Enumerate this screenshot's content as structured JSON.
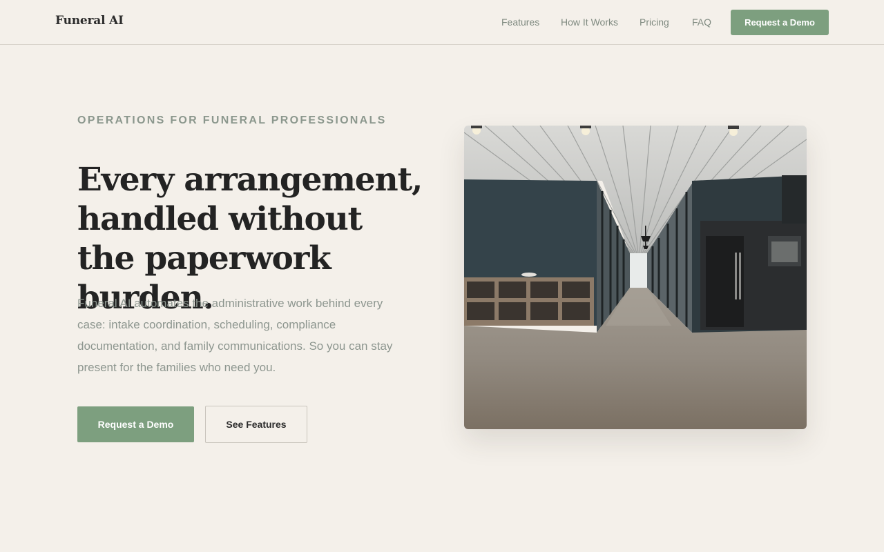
{
  "header": {
    "logo": "Funeral AI",
    "nav": [
      {
        "label": "Features"
      },
      {
        "label": "How It Works"
      },
      {
        "label": "Pricing"
      },
      {
        "label": "FAQ"
      }
    ],
    "cta_label": "Request a Demo"
  },
  "hero": {
    "eyebrow": "OPERATIONS FOR FUNERAL PROFESSIONALS",
    "headline": "Every arrangement, handled without the paperwork burden.",
    "lead": "Funeral AI automates the administrative work behind every case: intake coordination, scheduling, compliance documentation, and family communications. So you can stay present for the families who need you.",
    "primary_button": "Request a Demo",
    "secondary_button": "See Features"
  },
  "colors": {
    "background": "#f4f0ea",
    "accent": "#7d9f7f",
    "muted_text": "#8d968f",
    "heading_text": "#232323"
  }
}
